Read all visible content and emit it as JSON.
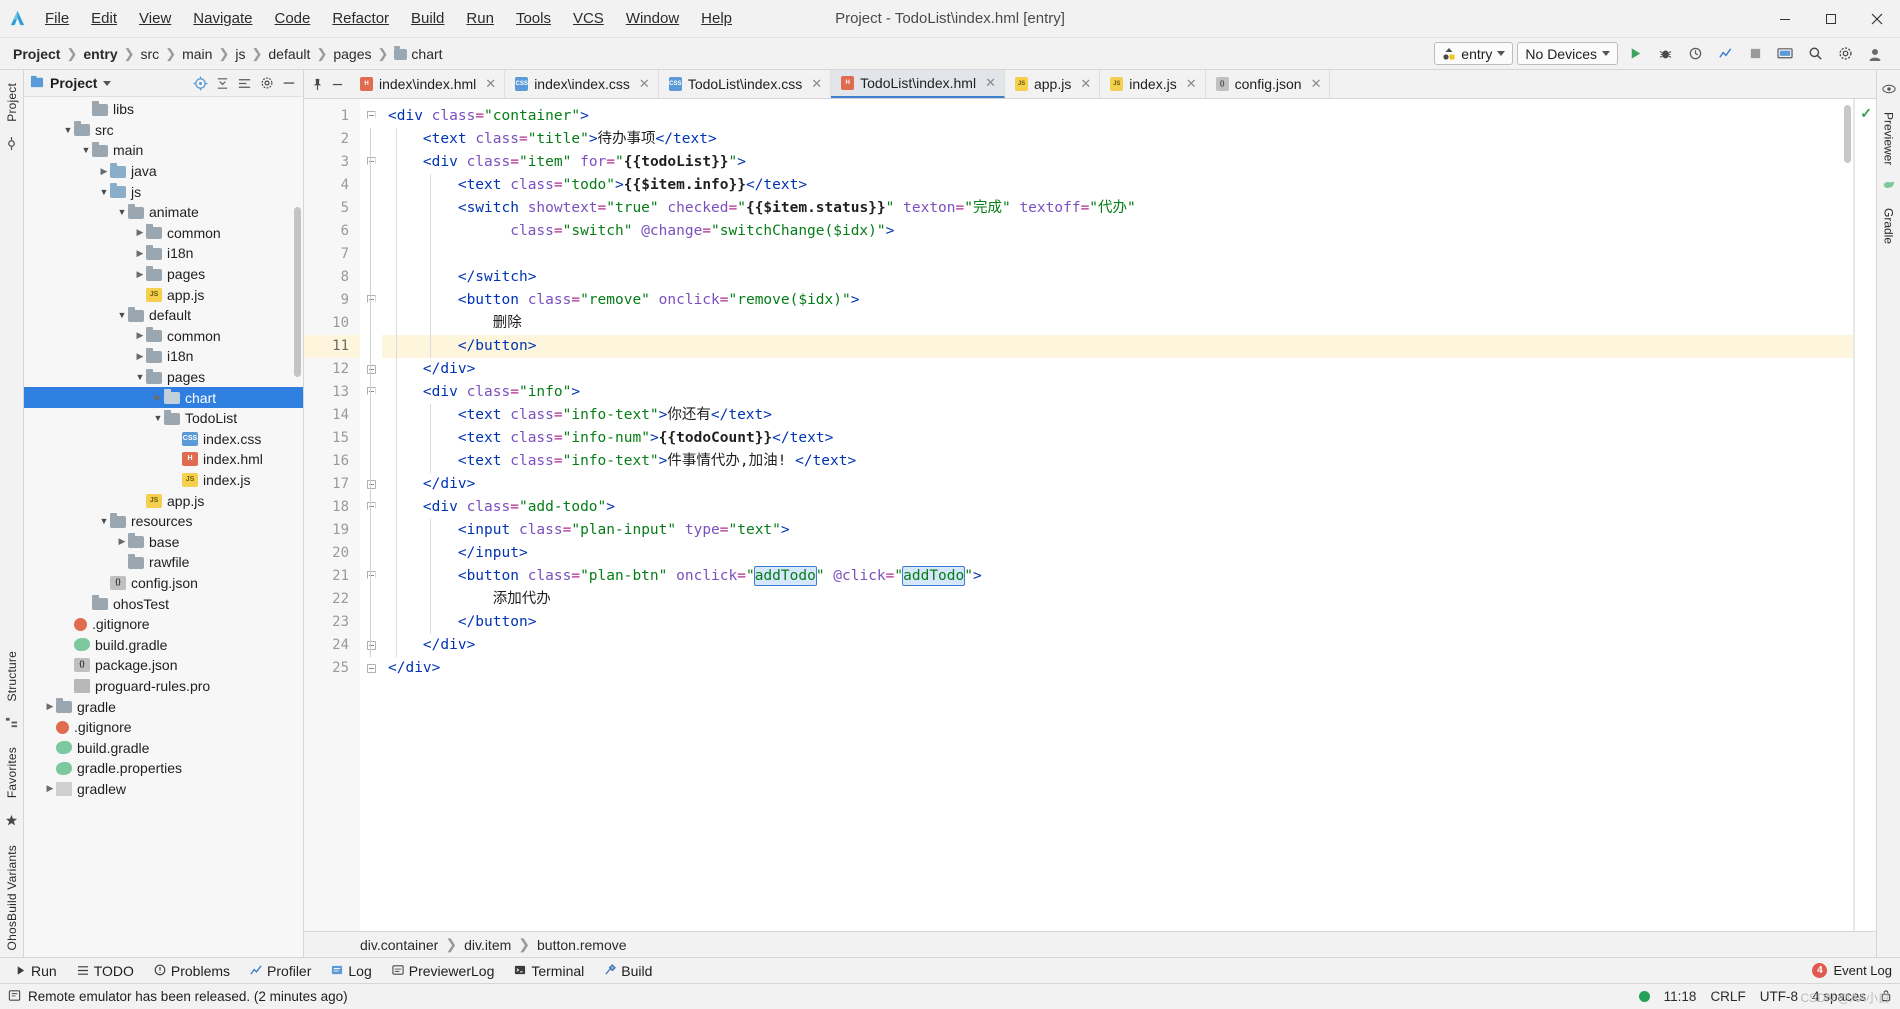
{
  "window": {
    "title": "Project - TodoList\\index.hml [entry]",
    "minimize": "─",
    "maximize": "☐",
    "close": "✕"
  },
  "menu": {
    "items": [
      "File",
      "Edit",
      "View",
      "Navigate",
      "Code",
      "Refactor",
      "Build",
      "Run",
      "Tools",
      "VCS",
      "Window",
      "Help"
    ]
  },
  "breadcrumb": {
    "items": [
      "Project",
      "entry",
      "src",
      "main",
      "js",
      "default",
      "pages",
      "chart"
    ]
  },
  "toolbar": {
    "module_selector": "entry",
    "device_selector": "No Devices",
    "run_icon": "run-icon",
    "debug_icon": "debug-icon",
    "attach_icon": "attach-debugger-icon",
    "profile_icon": "profiler-icon",
    "stop_icon": "stop-icon",
    "device_manager_icon": "device-manager-icon",
    "search_icon": "search-everywhere-icon",
    "settings_icon": "settings-icon",
    "account_icon": "account-icon"
  },
  "left_rail": {
    "top_label": "Project",
    "labels": [
      "Structure",
      "Favorites"
    ],
    "bottom_icon": "bookmark-star-icon"
  },
  "right_rail": {
    "labels": [
      "Previewer",
      "Gradle"
    ]
  },
  "project_panel": {
    "title": "Project",
    "dropdown": "▾",
    "icons": [
      "target-icon",
      "collapse-all-icon",
      "expand-icon",
      "settings-icon",
      "hide-icon"
    ],
    "tree": [
      {
        "label": "libs",
        "depth": 3,
        "arrow": "",
        "icon": "folder",
        "sel": false
      },
      {
        "label": "src",
        "depth": 2,
        "arrow": "v",
        "icon": "folder",
        "sel": false
      },
      {
        "label": "main",
        "depth": 3,
        "arrow": "v",
        "icon": "folder",
        "sel": false
      },
      {
        "label": "java",
        "depth": 4,
        "arrow": ">",
        "icon": "srcfolder",
        "sel": false
      },
      {
        "label": "js",
        "depth": 4,
        "arrow": "v",
        "icon": "srcfolder",
        "sel": false
      },
      {
        "label": "animate",
        "depth": 5,
        "arrow": "v",
        "icon": "folder",
        "sel": false
      },
      {
        "label": "common",
        "depth": 6,
        "arrow": ">",
        "icon": "folder",
        "sel": false
      },
      {
        "label": "i18n",
        "depth": 6,
        "arrow": ">",
        "icon": "folder",
        "sel": false
      },
      {
        "label": "pages",
        "depth": 6,
        "arrow": ">",
        "icon": "folder",
        "sel": false
      },
      {
        "label": "app.js",
        "depth": 6,
        "arrow": "",
        "icon": "js",
        "sel": false
      },
      {
        "label": "default",
        "depth": 5,
        "arrow": "v",
        "icon": "folder",
        "sel": false
      },
      {
        "label": "common",
        "depth": 6,
        "arrow": ">",
        "icon": "folder",
        "sel": false
      },
      {
        "label": "i18n",
        "depth": 6,
        "arrow": ">",
        "icon": "folder",
        "sel": false
      },
      {
        "label": "pages",
        "depth": 6,
        "arrow": "v",
        "icon": "folder",
        "sel": false
      },
      {
        "label": "chart",
        "depth": 7,
        "arrow": ">",
        "icon": "folder",
        "sel": true
      },
      {
        "label": "TodoList",
        "depth": 7,
        "arrow": "v",
        "icon": "folder",
        "sel": false
      },
      {
        "label": "index.css",
        "depth": 8,
        "arrow": "",
        "icon": "css",
        "sel": false
      },
      {
        "label": "index.hml",
        "depth": 8,
        "arrow": "",
        "icon": "hml",
        "sel": false
      },
      {
        "label": "index.js",
        "depth": 8,
        "arrow": "",
        "icon": "js",
        "sel": false
      },
      {
        "label": "app.js",
        "depth": 6,
        "arrow": "",
        "icon": "js",
        "sel": false
      },
      {
        "label": "resources",
        "depth": 4,
        "arrow": "v",
        "icon": "folder",
        "sel": false
      },
      {
        "label": "base",
        "depth": 5,
        "arrow": ">",
        "icon": "folder",
        "sel": false
      },
      {
        "label": "rawfile",
        "depth": 5,
        "arrow": "",
        "icon": "folder",
        "sel": false
      },
      {
        "label": "config.json",
        "depth": 4,
        "arrow": "",
        "icon": "json",
        "sel": false
      },
      {
        "label": "ohosTest",
        "depth": 3,
        "arrow": "",
        "icon": "folder",
        "sel": false
      },
      {
        "label": ".gitignore",
        "depth": 2,
        "arrow": "",
        "icon": "git",
        "sel": false
      },
      {
        "label": "build.gradle",
        "depth": 2,
        "arrow": "",
        "icon": "gradle",
        "sel": false
      },
      {
        "label": "package.json",
        "depth": 2,
        "arrow": "",
        "icon": "json",
        "sel": false
      },
      {
        "label": "proguard-rules.pro",
        "depth": 2,
        "arrow": "",
        "icon": "pro",
        "sel": false
      },
      {
        "label": "gradle",
        "depth": 1,
        "arrow": ">",
        "icon": "folder",
        "sel": false
      },
      {
        "label": ".gitignore",
        "depth": 1,
        "arrow": "",
        "icon": "git",
        "sel": false
      },
      {
        "label": "build.gradle",
        "depth": 1,
        "arrow": "",
        "icon": "gradle",
        "sel": false
      },
      {
        "label": "gradle.properties",
        "depth": 1,
        "arrow": "",
        "icon": "gradle",
        "sel": false
      },
      {
        "label": "gradlew",
        "depth": 1,
        "arrow": ">",
        "icon": "file",
        "sel": false
      }
    ]
  },
  "editor": {
    "tabs": [
      {
        "label": "index\\index.hml",
        "type": "hml",
        "active": false
      },
      {
        "label": "index\\index.css",
        "type": "css",
        "active": false
      },
      {
        "label": "TodoList\\index.css",
        "type": "css",
        "active": false
      },
      {
        "label": "TodoList\\index.hml",
        "type": "hml",
        "active": true
      },
      {
        "label": "app.js",
        "type": "js",
        "active": false
      },
      {
        "label": "index.js",
        "type": "js",
        "active": false
      },
      {
        "label": "config.json",
        "type": "json",
        "active": false
      }
    ],
    "tab_close": "✕",
    "current_line": 11,
    "inspection_status": "✓",
    "lines": [
      {
        "n": 1,
        "text": "<div class=\"container\">"
      },
      {
        "n": 2,
        "text": "    <text class=\"title\">待办事项</text>"
      },
      {
        "n": 3,
        "text": "    <div class=\"item\" for=\"{{todoList}}\">"
      },
      {
        "n": 4,
        "text": "        <text class=\"todo\">{{$item.info}}</text>"
      },
      {
        "n": 5,
        "text": "        <switch showtext=\"true\" checked=\"{{$item.status}}\" texton=\"完成\" textoff=\"代办\""
      },
      {
        "n": 6,
        "text": "              class=\"switch\" @change=\"switchChange($idx)\">"
      },
      {
        "n": 7,
        "text": ""
      },
      {
        "n": 8,
        "text": "        </switch>"
      },
      {
        "n": 9,
        "text": "        <button class=\"remove\" onclick=\"remove($idx)\">"
      },
      {
        "n": 10,
        "text": "            删除"
      },
      {
        "n": 11,
        "text": "        </button>"
      },
      {
        "n": 12,
        "text": "    </div>"
      },
      {
        "n": 13,
        "text": "    <div class=\"info\">"
      },
      {
        "n": 14,
        "text": "        <text class=\"info-text\">你还有</text>"
      },
      {
        "n": 15,
        "text": "        <text class=\"info-num\">{{todoCount}}</text>"
      },
      {
        "n": 16,
        "text": "        <text class=\"info-text\">件事情代办,加油! </text>"
      },
      {
        "n": 17,
        "text": "    </div>"
      },
      {
        "n": 18,
        "text": "    <div class=\"add-todo\">"
      },
      {
        "n": 19,
        "text": "        <input class=\"plan-input\" type=\"text\">"
      },
      {
        "n": 20,
        "text": "        </input>"
      },
      {
        "n": 21,
        "text": "        <button class=\"plan-btn\" onclick=\"addTodo\" @click=\"addTodo\">"
      },
      {
        "n": 22,
        "text": "            添加代办"
      },
      {
        "n": 23,
        "text": "        </button>"
      },
      {
        "n": 24,
        "text": "    </div>"
      },
      {
        "n": 25,
        "text": "</div>"
      }
    ],
    "selected_token": "addTodo"
  },
  "editor_breadcrumb": {
    "items": [
      "div.container",
      "div.item",
      "button.remove"
    ]
  },
  "tool_window_bar": {
    "items": [
      {
        "label": "Run",
        "icon": "run-icon"
      },
      {
        "label": "TODO",
        "icon": "todo-icon"
      },
      {
        "label": "Problems",
        "icon": "problems-icon"
      },
      {
        "label": "Profiler",
        "icon": "profiler-icon"
      },
      {
        "label": "Log",
        "icon": "log-icon"
      },
      {
        "label": "PreviewerLog",
        "icon": "previewer-log-icon"
      },
      {
        "label": "Terminal",
        "icon": "terminal-icon"
      },
      {
        "label": "Build",
        "icon": "build-icon"
      }
    ],
    "event_log": "Event Log",
    "event_count": "4"
  },
  "statusbar": {
    "message": "Remote emulator has been released. (2 minutes ago)",
    "time": "11:18",
    "line_sep": "CRLF",
    "encoding": "UTF-8",
    "indent": "4 spaces",
    "lock_icon": "lock-icon",
    "watermark": "CSDN @AA小白"
  },
  "colors": {
    "accent": "#3c7fd0",
    "selection": "#2f7fe0",
    "current_line": "#fdf6dd",
    "string": "#067d17",
    "tag": "#0033b3",
    "attr": "#7b4fbf"
  }
}
